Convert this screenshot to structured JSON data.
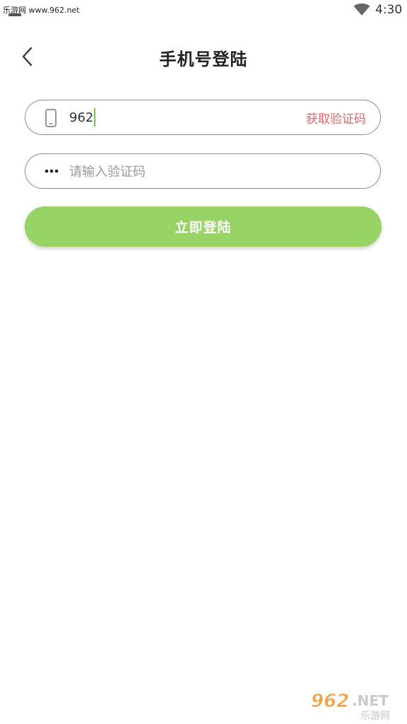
{
  "status_bar": {
    "watermark_text": "乐游网 www.962.net",
    "time": "4:30",
    "icons": [
      "notification-icon",
      "wifi-icon"
    ]
  },
  "header": {
    "title": "手机号登陆",
    "back_icon": "chevron-left-icon"
  },
  "phone_field": {
    "icon": "phone-icon",
    "value": "962",
    "get_code_label": "获取验证码"
  },
  "code_field": {
    "icon": "dots-icon",
    "placeholder": "请输入验证码",
    "value": ""
  },
  "login_button": {
    "label": "立即登陆"
  },
  "watermark_logo": {
    "text_main": "962",
    "text_suffix": ".NET",
    "text_sub": "乐游网"
  },
  "colors": {
    "accent_green": "#97d465",
    "get_code_red": "#e06a6a",
    "caret_green": "#7cc04a",
    "field_border": "#8a8a8a"
  }
}
